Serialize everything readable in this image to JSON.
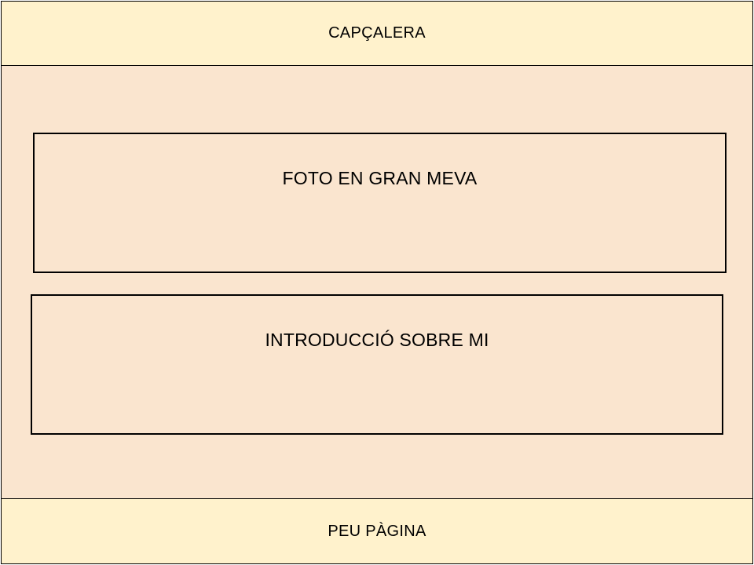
{
  "header": {
    "label": "CAPÇALERA"
  },
  "sections": {
    "photo": {
      "label": "FOTO EN GRAN MEVA"
    },
    "intro": {
      "label": "INTRODUCCIÓ SOBRE MI"
    }
  },
  "footer": {
    "label": "PEU PÀGINA"
  },
  "colors": {
    "band_fill": "#fff2cc",
    "body_fill": "#fae5cf",
    "stroke": "#000000"
  }
}
